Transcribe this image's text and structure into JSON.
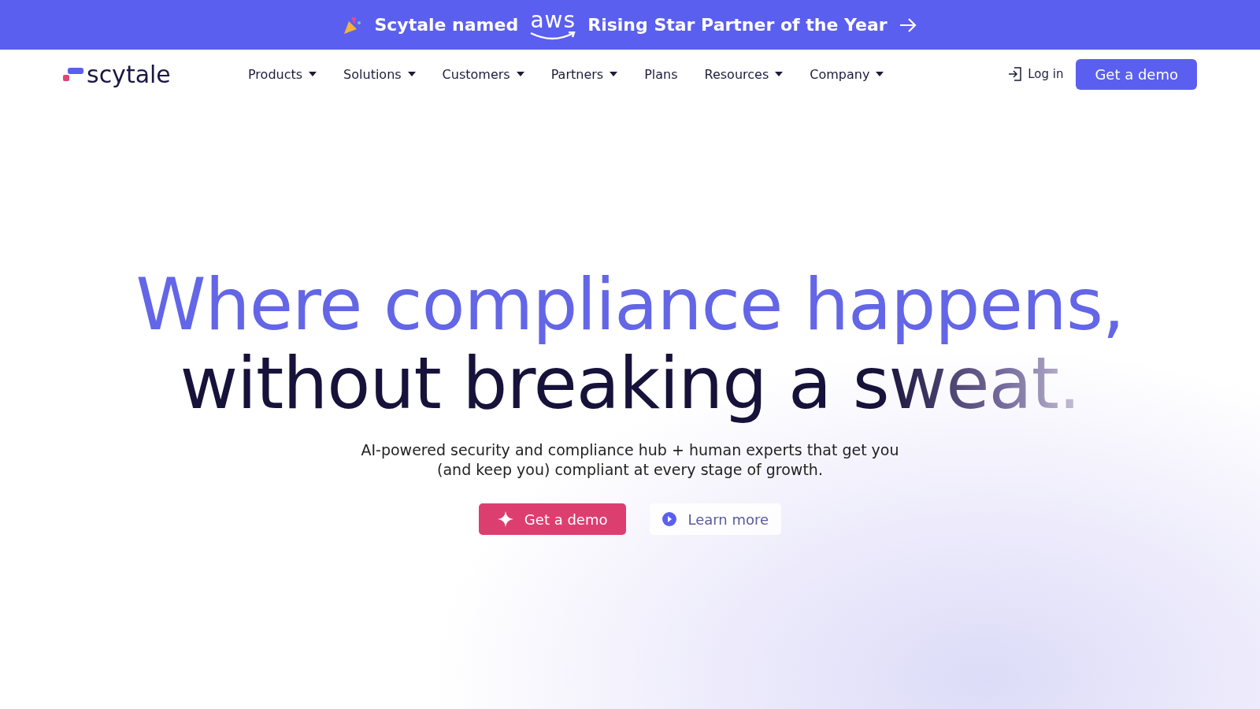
{
  "banner": {
    "lead": "Scytale named",
    "logo": "aws",
    "tail": "Rising Star Partner of the Year"
  },
  "nav": {
    "logo": "scytale",
    "items": [
      {
        "label": "Products",
        "dropdown": true
      },
      {
        "label": "Solutions",
        "dropdown": true
      },
      {
        "label": "Customers",
        "dropdown": true
      },
      {
        "label": "Partners",
        "dropdown": true
      },
      {
        "label": "Plans",
        "dropdown": false
      },
      {
        "label": "Resources",
        "dropdown": true
      },
      {
        "label": "Company",
        "dropdown": true
      }
    ],
    "login": "Log in",
    "cta": "Get a demo"
  },
  "hero": {
    "line1": "Where compliance happens,",
    "line2": "without breaking a sweat.",
    "subtitle": "AI-powered security and compliance hub + human experts that get you (and keep you) compliant at every stage of growth.",
    "primary": "Get a demo",
    "secondary": "Learn more"
  }
}
